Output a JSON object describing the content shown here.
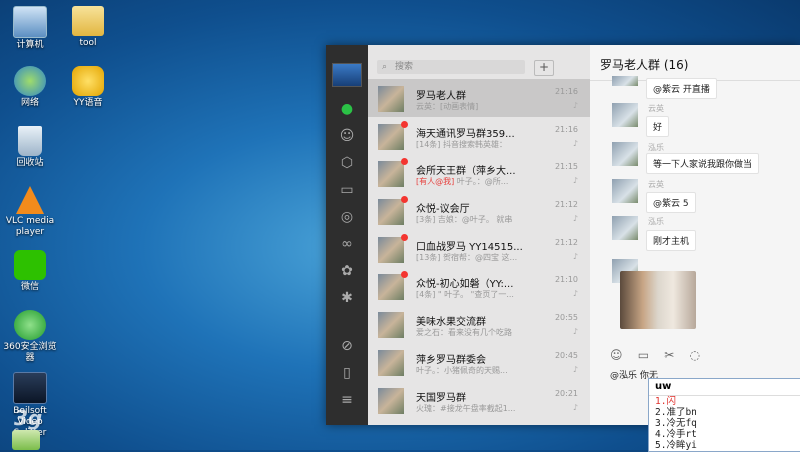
{
  "desktop": {
    "icons": [
      {
        "label": "计算机"
      },
      {
        "label": "tool"
      },
      {
        "label": "网络"
      },
      {
        "label": "YY语音"
      },
      {
        "label": "回收站"
      },
      {
        "label": "VLC media player"
      },
      {
        "label": "微信"
      },
      {
        "label": "360安全浏览器"
      },
      {
        "label": "Boilsoft Video Splitter"
      }
    ],
    "watermark": "3g"
  },
  "wechat": {
    "search_placeholder": "搜索",
    "add_label": "+",
    "conversations": [
      {
        "name": "罗马老人群",
        "time": "21:16",
        "preview": "云英：[动画表情]",
        "mention": ""
      },
      {
        "name": "海天通讯罗马群359...",
        "time": "21:16",
        "preview": "[14条] 抖音搜索韩英雄：",
        "mention": ""
      },
      {
        "name": "会所天王群（萍乡大...",
        "time": "21:15",
        "preview": " 叶子。：@所...",
        "mention": "[有人@我]"
      },
      {
        "name": "众悦-议会厅",
        "time": "21:12",
        "preview": "[3条] 吉娘：@叶子。 就串",
        "mention": ""
      },
      {
        "name": "口血战罗马 YY14515...",
        "time": "21:12",
        "preview": "[13条] 贺宿帮：@四宝 这...",
        "mention": ""
      },
      {
        "name": "众悦-初心如磐（YY:...",
        "time": "21:10",
        "preview": "[4条] \" 叶子。 \"查页了一...",
        "mention": ""
      },
      {
        "name": "美味水果交流群",
        "time": "20:55",
        "preview": "爱之石：看来没有几个吃路",
        "mention": ""
      },
      {
        "name": "萍乡罗马群委会",
        "time": "20:45",
        "preview": "叶子。：小猪佩奇的天赐...",
        "mention": ""
      },
      {
        "name": "天国罗马群",
        "time": "20:21",
        "preview": "火瑰：#接龙午盘率截起1...",
        "mention": ""
      }
    ],
    "chat": {
      "title": "罗马老人群 (16)",
      "messages": [
        {
          "sender": "",
          "text": "@紫云 开直播"
        },
        {
          "sender": "云英",
          "text": "好"
        },
        {
          "sender": "泓乐",
          "text": "等一下人家说我跟你做当"
        },
        {
          "sender": "云英",
          "text": "@紫云 5"
        },
        {
          "sender": "泓乐",
          "text": "刚才主机"
        }
      ],
      "input_text": "@泓乐 你无"
    }
  },
  "ime": {
    "code": "uw",
    "candidates": [
      "1.闪",
      "2.准了bn",
      "3.冷无fq",
      "4.冷手rt",
      "5.冷眸yi"
    ]
  }
}
